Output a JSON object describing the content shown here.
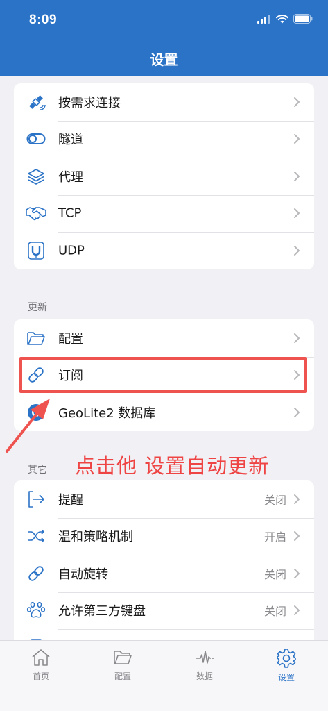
{
  "status_bar": {
    "time": "8:09"
  },
  "header": {
    "title": "设置"
  },
  "section_top": {
    "items": [
      {
        "label": "按需求连接",
        "icon": "satellite-icon"
      },
      {
        "label": "隧道",
        "icon": "toggle-icon"
      },
      {
        "label": "代理",
        "icon": "layers-icon"
      },
      {
        "label": "TCP",
        "icon": "handshake-icon"
      },
      {
        "label": "UDP",
        "icon": "magnet-icon"
      }
    ]
  },
  "section_update": {
    "title": "更新",
    "items": [
      {
        "label": "配置",
        "icon": "folder-icon"
      },
      {
        "label": "订阅",
        "icon": "link-icon"
      },
      {
        "label": "GeoLite2 数据库",
        "icon": "globe-icon"
      }
    ]
  },
  "section_other": {
    "title": "其它",
    "items": [
      {
        "label": "提醒",
        "value": "关闭",
        "icon": "sign-out-icon"
      },
      {
        "label": "温和策略机制",
        "value": "开启",
        "icon": "shuffle-icon"
      },
      {
        "label": "自动旋转",
        "value": "关闭",
        "icon": "link-icon"
      },
      {
        "label": "允许第三方键盘",
        "value": "关闭",
        "icon": "paw-icon"
      }
    ]
  },
  "annotation": {
    "text": "点击他  设置自动更新"
  },
  "tabbar": {
    "tabs": [
      {
        "label": "首页",
        "icon": "home-icon"
      },
      {
        "label": "配置",
        "icon": "folder-icon"
      },
      {
        "label": "数据",
        "icon": "pulse-icon"
      },
      {
        "label": "设置",
        "icon": "gear-icon",
        "active": true
      }
    ]
  },
  "colors": {
    "accent": "#2b73c7",
    "annotation": "#ef4444"
  }
}
